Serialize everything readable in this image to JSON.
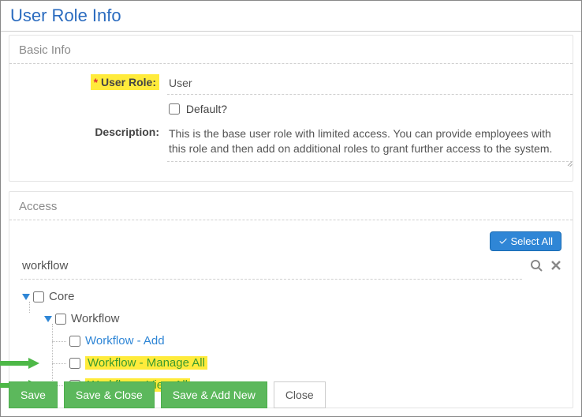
{
  "title": "User Role Info",
  "basic": {
    "legend": "Basic Info",
    "user_role_label": "User Role:",
    "required_mark": "*",
    "user_role_value": "User",
    "default_label": "Default?",
    "description_label": "Description:",
    "description_value": "This is the base user role with limited access.  You can provide employees with this role and then add on additional roles to grant further access to the system."
  },
  "access": {
    "legend": "Access",
    "select_all_label": "Select All",
    "search_value": "workflow",
    "tree": {
      "root": {
        "label": "Core",
        "checked": false,
        "expanded": true
      },
      "child": {
        "label": "Workflow",
        "checked": false,
        "expanded": true
      },
      "items": [
        {
          "label": "Workflow - Add",
          "checked": false,
          "highlight": false
        },
        {
          "label": "Workflow - Manage All",
          "checked": false,
          "highlight": true
        },
        {
          "label": "Workflow - View All",
          "checked": false,
          "highlight": true
        }
      ]
    }
  },
  "footer": {
    "save": "Save",
    "save_close": "Save & Close",
    "save_add": "Save & Add New",
    "close": "Close"
  }
}
